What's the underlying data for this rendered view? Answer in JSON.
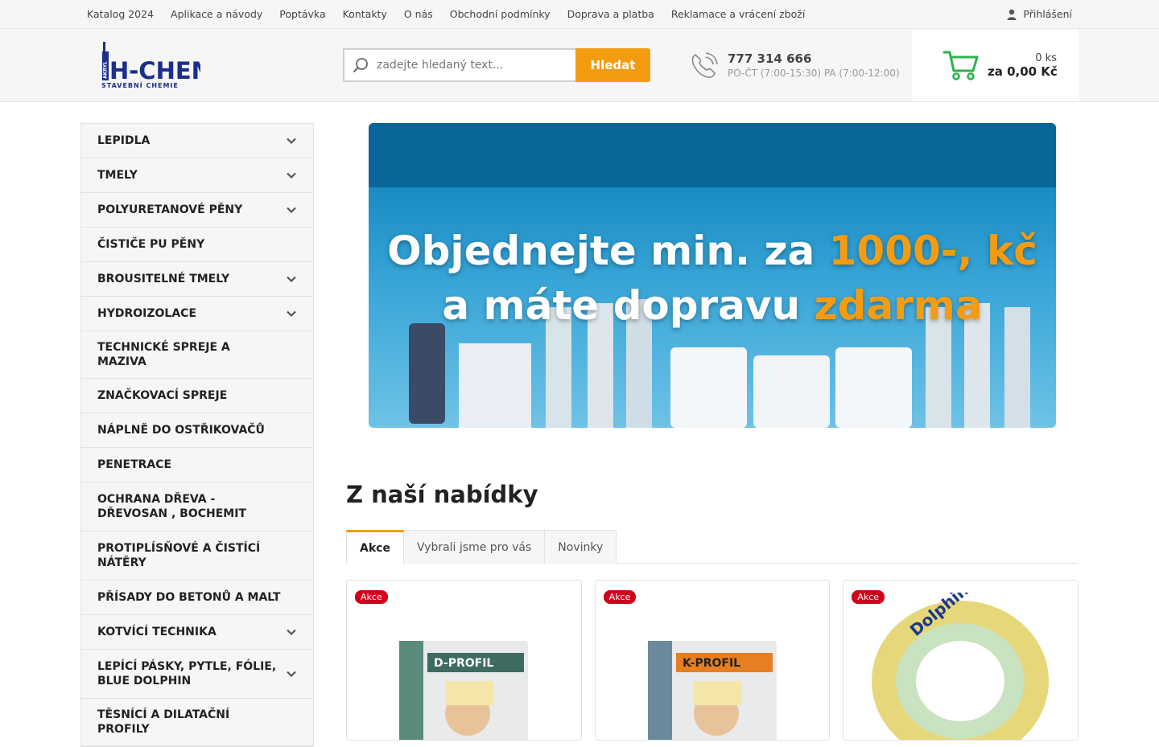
{
  "topnav": {
    "links": [
      "Katalog 2024",
      "Aplikace a návody",
      "Poptávka",
      "Kontakty",
      "O nás",
      "Obchodní podmínky",
      "Doprava a platba",
      "Reklamace a vrácení zboží"
    ],
    "login": "Přihlášení"
  },
  "header": {
    "logo_text": "H-CHEM",
    "logo_sub": "STAVEBNÍ CHEMIE",
    "logo_side": "AKRYL",
    "search_placeholder": "zadejte hledaný text...",
    "search_button": "Hledat",
    "phone": "777 314 666",
    "hours": "PO-ČT (7:00-15:30) PA (7:00-12:00)",
    "cart_count": "0 ks",
    "cart_total": "za 0,00 Kč"
  },
  "sidebar": {
    "categories": [
      {
        "label": "LEPIDLA",
        "expandable": true
      },
      {
        "label": "TMELY",
        "expandable": true
      },
      {
        "label": "POLYURETANOVÉ PĚNY",
        "expandable": true
      },
      {
        "label": "ČISTIČE PU PĚNY",
        "expandable": false
      },
      {
        "label": "BROUSITELNÉ TMELY",
        "expandable": true
      },
      {
        "label": "HYDROIZOLACE",
        "expandable": true
      },
      {
        "label": "TECHNICKÉ SPREJE A MAZIVA",
        "expandable": false
      },
      {
        "label": "ZNAČKOVACÍ SPREJE",
        "expandable": false
      },
      {
        "label": "NÁPLNĚ DO OSTŘIKOVAČŮ",
        "expandable": false
      },
      {
        "label": "PENETRACE",
        "expandable": false
      },
      {
        "label": "OCHRANA DŘEVA - DŘEVOSAN , BOCHEMIT",
        "expandable": false
      },
      {
        "label": "PROTIPLÍSŇOVÉ A ČISTÍCÍ NÁTĚRY",
        "expandable": false
      },
      {
        "label": "PŘÍSADY DO BETONŮ A MALT",
        "expandable": false
      },
      {
        "label": "KOTVÍCÍ TECHNIKA",
        "expandable": true
      },
      {
        "label": "LEPÍCÍ PÁSKY, PYTLE, FÓLIE, BLUE DOLPHIN",
        "expandable": true
      },
      {
        "label": "TĚSNÍCÍ A DILATAČNÍ PROFILY",
        "expandable": false
      }
    ]
  },
  "banner": {
    "line1_a": "Objednejte min. za ",
    "line1_b": "1000-, kč",
    "line2_a": "a máte dopravu ",
    "line2_b": "zdarma"
  },
  "offers": {
    "title": "Z naší nabídky",
    "tabs": [
      "Akce",
      "Vybrali jsme pro vás",
      "Novinky"
    ],
    "products": [
      {
        "badge": "Akce",
        "image": "D-PROFIL"
      },
      {
        "badge": "Akce",
        "image": "K-PROFIL"
      },
      {
        "badge": "Akce",
        "image": "Dolphin"
      }
    ]
  },
  "colors": {
    "accent": "#f39c12",
    "badge": "#d0021b",
    "cart_green": "#2bb34a",
    "logo_blue": "#1b2e8c"
  }
}
